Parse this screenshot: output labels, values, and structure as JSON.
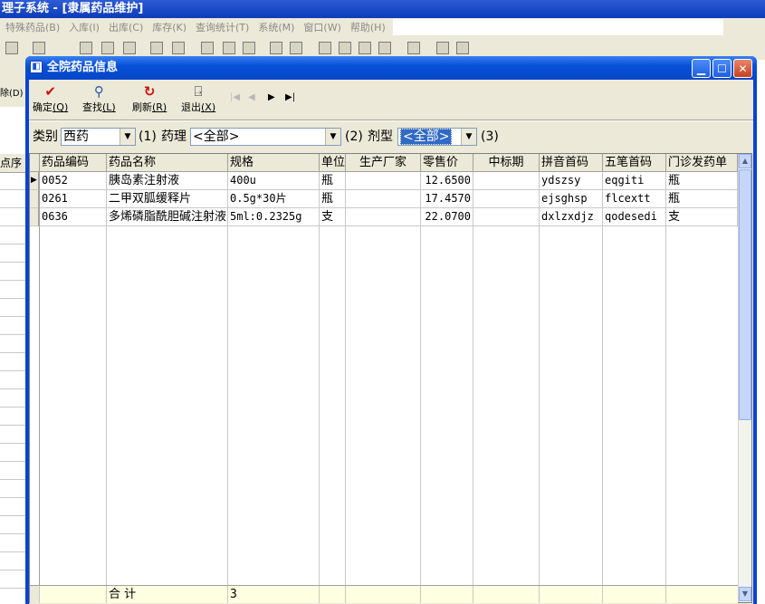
{
  "app": {
    "title": "理子系统 - [隶属药品维护]",
    "menu": [
      "特殊药品(B)",
      "入库(I)",
      "出库(C)",
      "库存(K)",
      "查询统计(T)",
      "系统(M)",
      "窗口(W)",
      "帮助(H)"
    ],
    "left_tool_label": "除(D)",
    "left_header": "点序"
  },
  "dialog": {
    "title": "全院药品信息",
    "toolbar": {
      "confirm": {
        "label": "确定",
        "key": "(Q)"
      },
      "find": {
        "label": "查找",
        "key": "(L)"
      },
      "refresh": {
        "label": "刷新",
        "key": "(R)"
      },
      "exit": {
        "label": "退出",
        "key": "(X)"
      }
    },
    "filters": {
      "category_label": "类别",
      "category_value": "西药",
      "marker1": "(1)",
      "pharm_label": "药理",
      "pharm_value": "<全部>",
      "marker2": "(2)",
      "form_label": "剂型",
      "form_value": "<全部>",
      "marker3": "(3)"
    },
    "grid": {
      "headers": [
        "药品编码",
        "药品名称",
        "规格",
        "单位",
        "生产厂家",
        "零售价",
        "中标期",
        "拼音首码",
        "五笔首码",
        "门诊发药单"
      ],
      "rows": [
        {
          "code": "0052",
          "name": "胰岛素注射液",
          "spec": "400u",
          "unit": "瓶",
          "maker": "",
          "price": "12.6500",
          "bid": "",
          "pinyin": "ydszsy",
          "wubi": "eqgiti",
          "dispense": "瓶"
        },
        {
          "code": "0261",
          "name": "二甲双胍缓释片",
          "spec": "0.5g*30片",
          "unit": "瓶",
          "maker": "",
          "price": "17.4570",
          "bid": "",
          "pinyin": "ejsghsp",
          "wubi": "flcextt",
          "dispense": "瓶"
        },
        {
          "code": "0636",
          "name": "多烯磷脂酰胆碱注射液",
          "spec": "5ml:0.2325g",
          "unit": "支",
          "maker": "",
          "price": "22.0700",
          "bid": "",
          "pinyin": "dxlzxdjz",
          "wubi": "qodesedi",
          "dispense": "支"
        }
      ],
      "footer": {
        "label": "合  计",
        "count": "3"
      }
    }
  },
  "colors": {
    "titlebar": "#0a4fd8",
    "selection": "#316ac5",
    "footer_bg": "#ffffe1"
  }
}
